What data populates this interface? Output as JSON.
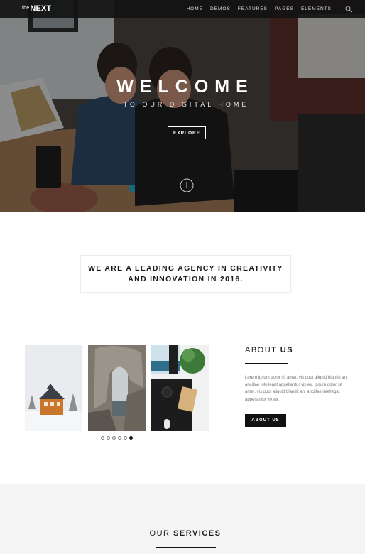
{
  "nav": {
    "logo_prefix": "the",
    "logo_main": "NEXT",
    "items": [
      "HOME",
      "DEMOS",
      "FEATURES",
      "PAGES",
      "ELEMENTS"
    ]
  },
  "hero": {
    "title": "WELCOME",
    "tagline": "TO OUR DIGITAL HOME",
    "button_label": "EXPLORE"
  },
  "statement": {
    "line1": "WE ARE A LEADING AGENCY IN CREATIVITY",
    "line2": "AND INNOVATION IN 2016."
  },
  "gallery": {
    "dot_count": 6,
    "active_dot": 6
  },
  "about": {
    "title_light": "ABOUT ",
    "title_bold": "US",
    "text": "Lorem ipsum dolor sit amet, vis quot aliquid blandit an, ancillae intellegat appellantur vix ex. Ipsum dolor sit amet, vis quot aliquid blandit an, ancillae intellegat appellantur vix ex.",
    "button_label": "ABOUT US"
  },
  "services": {
    "title_light": "OUR ",
    "title_bold": "SERVICES"
  },
  "colors": {
    "nav_bg": "#121212",
    "accent": "#111111",
    "services_bg": "#f5f5f5"
  }
}
